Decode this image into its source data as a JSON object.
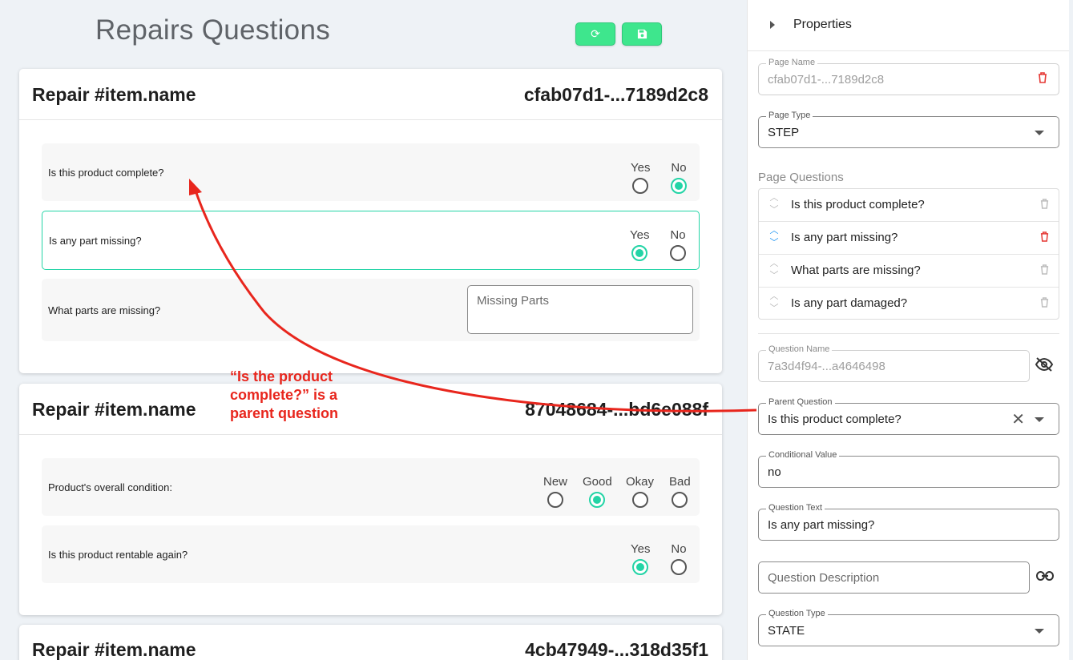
{
  "page_title": "Repairs Questions",
  "toolbar": {
    "refresh_icon": "⟳",
    "save_icon": "💾"
  },
  "cards": [
    {
      "title": "Repair #item.name",
      "id": "cfab07d1-...7189d2c8",
      "questions": [
        {
          "label": "Is this product complete?",
          "options": [
            "Yes",
            "No"
          ],
          "selected": "No"
        },
        {
          "label": "Is any part missing?",
          "options": [
            "Yes",
            "No"
          ],
          "selected": "Yes"
        },
        {
          "label": "What parts are missing?",
          "placeholder": "Missing Parts"
        }
      ]
    },
    {
      "title": "Repair #item.name",
      "id": "87048684-...bd6e088f",
      "questions": [
        {
          "label": "Product's overall condition:",
          "options": [
            "New",
            "Good",
            "Okay",
            "Bad"
          ],
          "selected": "Good"
        },
        {
          "label": "Is this product rentable again?",
          "options": [
            "Yes",
            "No"
          ],
          "selected": "Yes"
        }
      ]
    },
    {
      "title": "Repair #item.name",
      "id": "4cb47949-...318d35f1"
    }
  ],
  "annotation": "“Is the product complete?” is a parent question",
  "panel": {
    "title": "Properties",
    "page_name": {
      "label": "Page Name",
      "value": "cfab07d1-...7189d2c8"
    },
    "page_type": {
      "label": "Page Type",
      "value": "STEP"
    },
    "page_questions_label": "Page Questions",
    "page_questions": [
      "Is this product complete?",
      "Is any part missing?",
      "What parts are missing?",
      "Is any part damaged?"
    ],
    "question_name": {
      "label": "Question Name",
      "value": "7a3d4f94-...a4646498"
    },
    "parent_question": {
      "label": "Parent Question",
      "value": "Is this product complete?"
    },
    "conditional_value": {
      "label": "Conditional Value",
      "value": "no"
    },
    "question_text": {
      "label": "Question Text",
      "value": "Is any part missing?"
    },
    "question_description": {
      "placeholder": "Question Description"
    },
    "question_type": {
      "label": "Question Type",
      "value": "STATE"
    }
  },
  "colors": {
    "accent": "#23d4a6",
    "button_green": "#3ee68d",
    "annotation_red": "#e8261d",
    "delete_red": "#e53935"
  }
}
